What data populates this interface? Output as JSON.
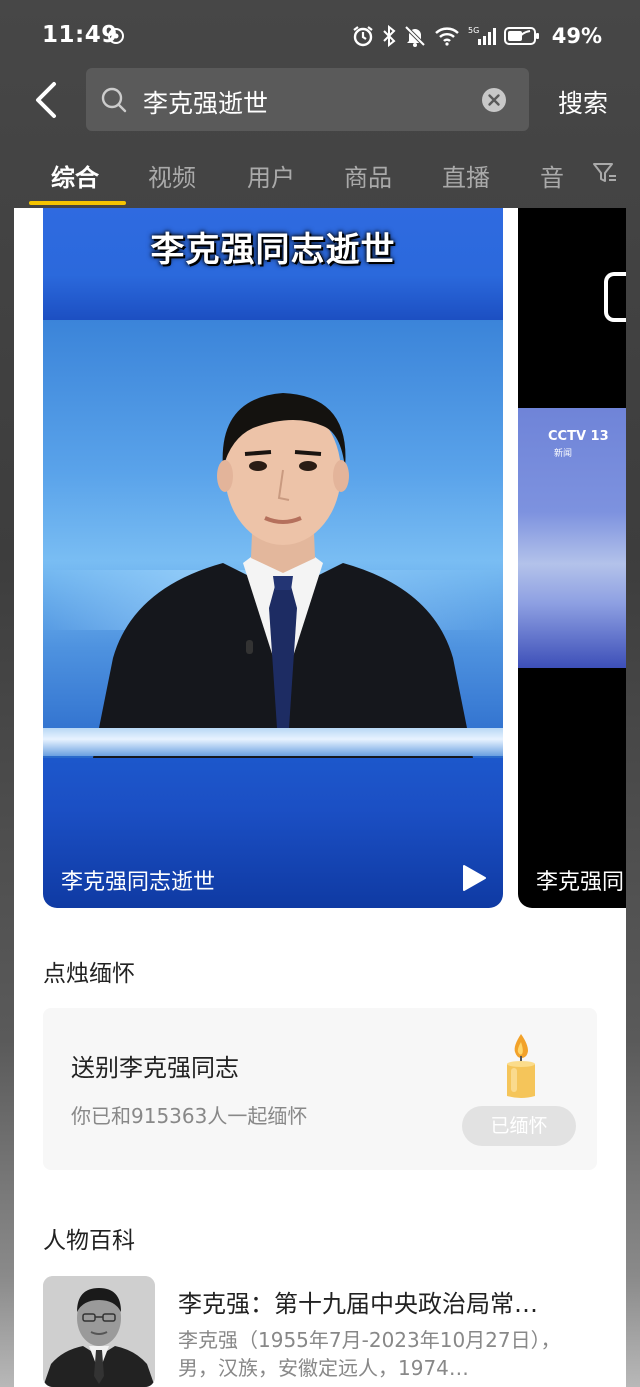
{
  "status_bar": {
    "time": "11:49",
    "network": "5G",
    "battery": "49%"
  },
  "search": {
    "query": "李克强逝世",
    "submit_label": "搜索"
  },
  "tabs": [
    {
      "label": "综合",
      "active": true
    },
    {
      "label": "视频",
      "active": false
    },
    {
      "label": "用户",
      "active": false
    },
    {
      "label": "商品",
      "active": false
    },
    {
      "label": "直播",
      "active": false
    },
    {
      "label": "音",
      "active": false
    }
  ],
  "videos": [
    {
      "overlay_title": "李克强同志逝世",
      "caption": "李克强同志逝世"
    },
    {
      "logo": "CCTV 13",
      "logo_sub": "新闻",
      "caption": "李克强同"
    }
  ],
  "candle_section": {
    "heading": "点烛缅怀",
    "title": "送别李克强同志",
    "subtitle": "你已和915363人一起缅怀",
    "button_label": "已缅怀"
  },
  "encyclopedia_section": {
    "heading": "人物百科",
    "title": "李克强：第十九届中央政治局常…",
    "description": "李克强（1955年7月-2023年10月27日），男，汉族，安徽定远人，1974…"
  },
  "colors": {
    "accent": "#f5c400",
    "header_bg": "#474747",
    "search_box_bg": "#5a5a5a"
  },
  "icons": [
    "back-arrow-icon",
    "search-icon",
    "clear-icon",
    "filter-icon",
    "play-icon",
    "candle-icon",
    "alarm-icon",
    "bluetooth-icon",
    "mute-icon",
    "wifi-icon",
    "signal-icon",
    "battery-icon",
    "hotspot-icon"
  ]
}
